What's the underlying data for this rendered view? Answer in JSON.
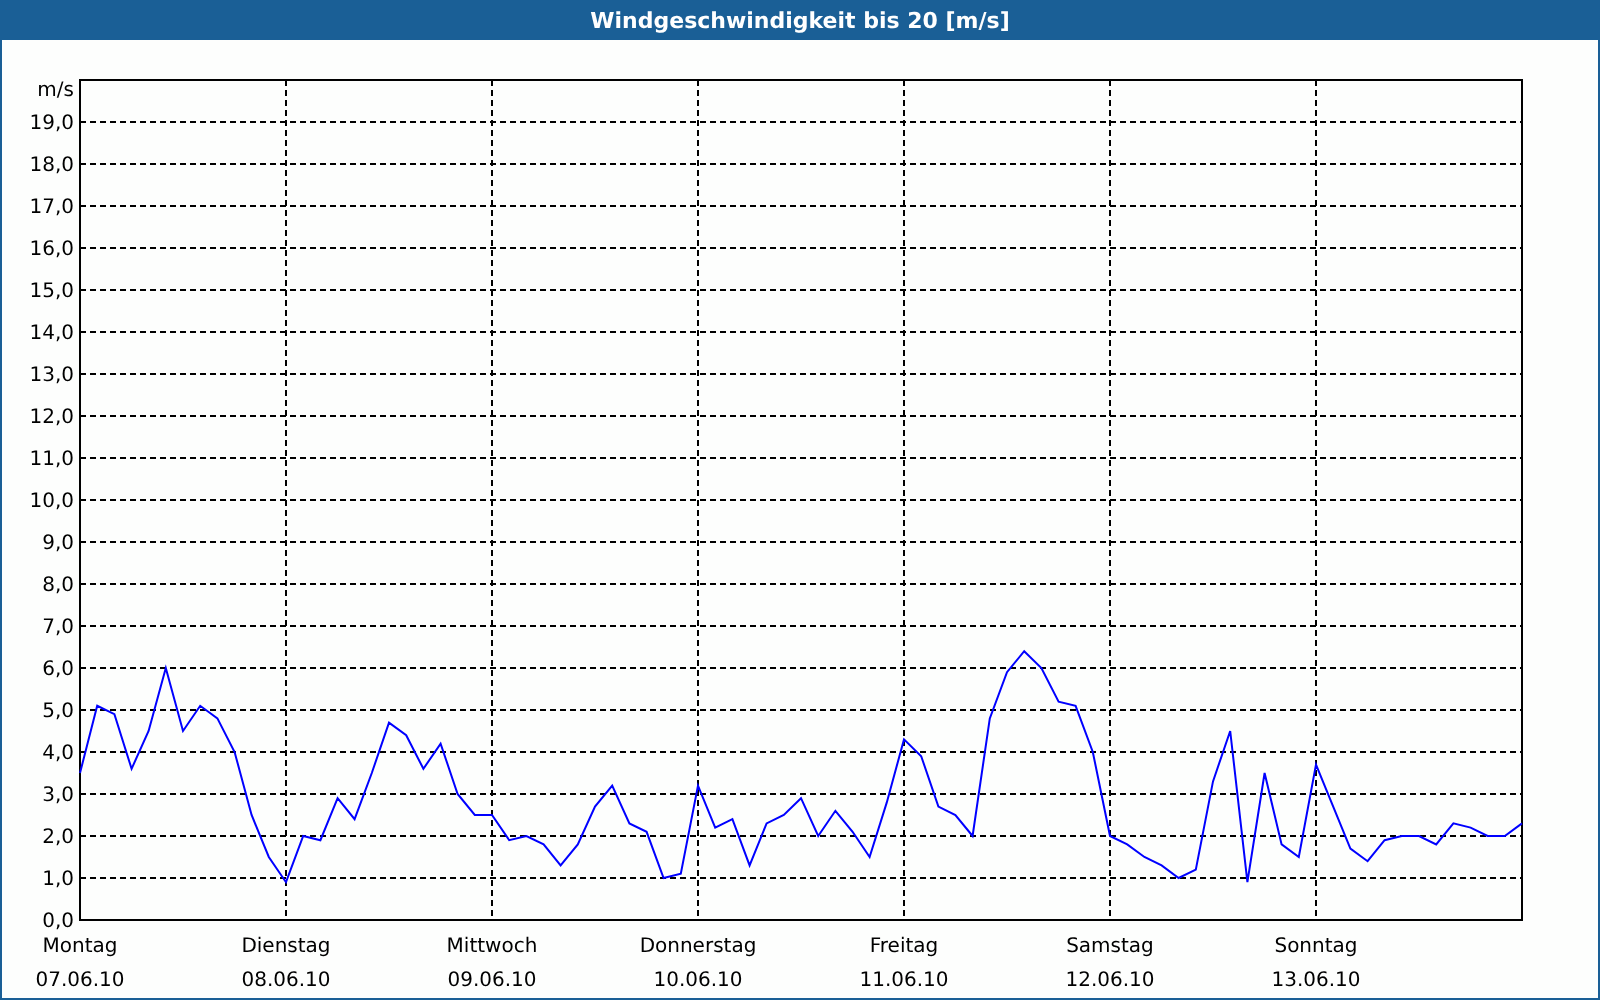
{
  "header": {
    "title": "Windgeschwindigkeit bis 20 [m/s]"
  },
  "chart": {
    "chart_data": {
      "type": "line",
      "ylabel": "m/s",
      "ylim": [
        0,
        20
      ],
      "grid": true,
      "categories": [
        "Montag\n07.06.10",
        null,
        null,
        null,
        null,
        null,
        null,
        null,
        null,
        null,
        null,
        null,
        "Dienstag\n08.06.10",
        null,
        null,
        null,
        null,
        null,
        null,
        null,
        null,
        null,
        null,
        null,
        "Mittwoch\n09.06.10",
        null,
        null,
        null,
        null,
        null,
        null,
        null,
        null,
        null,
        null,
        null,
        "Donnerstag\n10.06.10",
        null,
        null,
        null,
        null,
        null,
        null,
        null,
        null,
        null,
        null,
        null,
        "Freitag\n11.06.10",
        null,
        null,
        null,
        null,
        null,
        null,
        null,
        null,
        null,
        null,
        null,
        "Samstag\n12.06.10",
        null,
        null,
        null,
        null,
        null,
        null,
        null,
        null,
        null,
        null,
        null,
        "Sonntag\n13.06.10",
        null,
        null,
        null,
        null,
        null,
        null,
        null,
        null,
        null,
        null,
        null,
        null
      ],
      "series": [
        {
          "color": "#0000ff",
          "values": [
            3.5,
            5.1,
            4.9,
            3.6,
            4.5,
            6.0,
            4.5,
            5.1,
            4.8,
            4.0,
            2.5,
            1.5,
            0.9,
            2.0,
            1.9,
            2.9,
            2.4,
            3.5,
            4.7,
            4.4,
            3.6,
            4.2,
            3.0,
            2.5,
            2.5,
            1.9,
            2.0,
            1.8,
            1.3,
            1.8,
            2.7,
            3.2,
            2.3,
            2.1,
            1.0,
            1.1,
            3.2,
            2.2,
            2.4,
            1.3,
            2.3,
            2.5,
            2.9,
            2.0,
            2.6,
            2.1,
            1.5,
            2.8,
            4.3,
            3.9,
            2.7,
            2.5,
            2.0,
            4.8,
            5.9,
            6.4,
            6.0,
            5.2,
            5.1,
            4.0,
            2.0,
            1.8,
            1.5,
            1.3,
            1.0,
            1.2,
            3.3,
            4.5,
            0.9,
            3.5,
            1.8,
            1.5,
            3.7,
            2.7,
            1.7,
            1.4,
            1.9,
            2.0,
            2.0,
            1.8,
            2.3,
            2.2,
            2.0,
            2.0,
            2.3
          ]
        }
      ],
      "yticks": [
        {
          "value": 0,
          "label": "0,0"
        },
        {
          "value": 1,
          "label": "1,0"
        },
        {
          "value": 2,
          "label": "2,0"
        },
        {
          "value": 3,
          "label": "3,0"
        },
        {
          "value": 4,
          "label": "4,0"
        },
        {
          "value": 5,
          "label": "5,0"
        },
        {
          "value": 6,
          "label": "6,0"
        },
        {
          "value": 7,
          "label": "7,0"
        },
        {
          "value": 8,
          "label": "8,0"
        },
        {
          "value": 9,
          "label": "9,0"
        },
        {
          "value": 10,
          "label": "10,0"
        },
        {
          "value": 11,
          "label": "11,0"
        },
        {
          "value": 12,
          "label": "12,0"
        },
        {
          "value": 13,
          "label": "13,0"
        },
        {
          "value": 14,
          "label": "14,0"
        },
        {
          "value": 15,
          "label": "15,0"
        },
        {
          "value": 16,
          "label": "16,0"
        },
        {
          "value": 17,
          "label": "17,0"
        },
        {
          "value": 18,
          "label": "18,0"
        },
        {
          "value": 19,
          "label": "19,0"
        }
      ]
    }
  }
}
